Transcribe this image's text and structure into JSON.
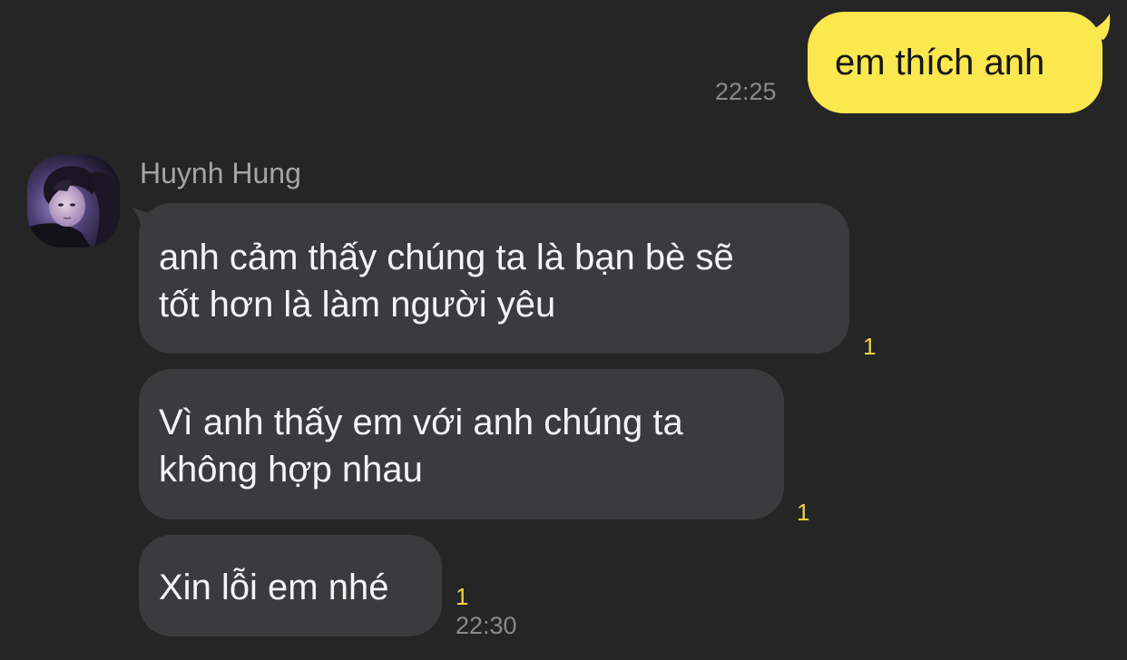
{
  "outgoing": {
    "text": "em thích anh",
    "time": "22:25",
    "bubble_color": "#fbe74e"
  },
  "sender": {
    "name": "Huynh Hung",
    "avatar_icon": "profile-photo"
  },
  "incoming": [
    {
      "lines": [
        "anh cảm thấy chúng ta là bạn bè sẽ",
        "tốt hơn là làm người yêu"
      ],
      "unread": "1"
    },
    {
      "lines": [
        "Vì anh thấy em với anh chúng ta",
        "không hợp nhau"
      ],
      "unread": "1"
    },
    {
      "lines": [
        "Xin lỗi em nhé"
      ],
      "unread": "1",
      "time": "22:30"
    }
  ],
  "colors": {
    "background": "#252526",
    "incoming_bubble": "#3b3b3d",
    "unread_count": "#f2d33b"
  }
}
